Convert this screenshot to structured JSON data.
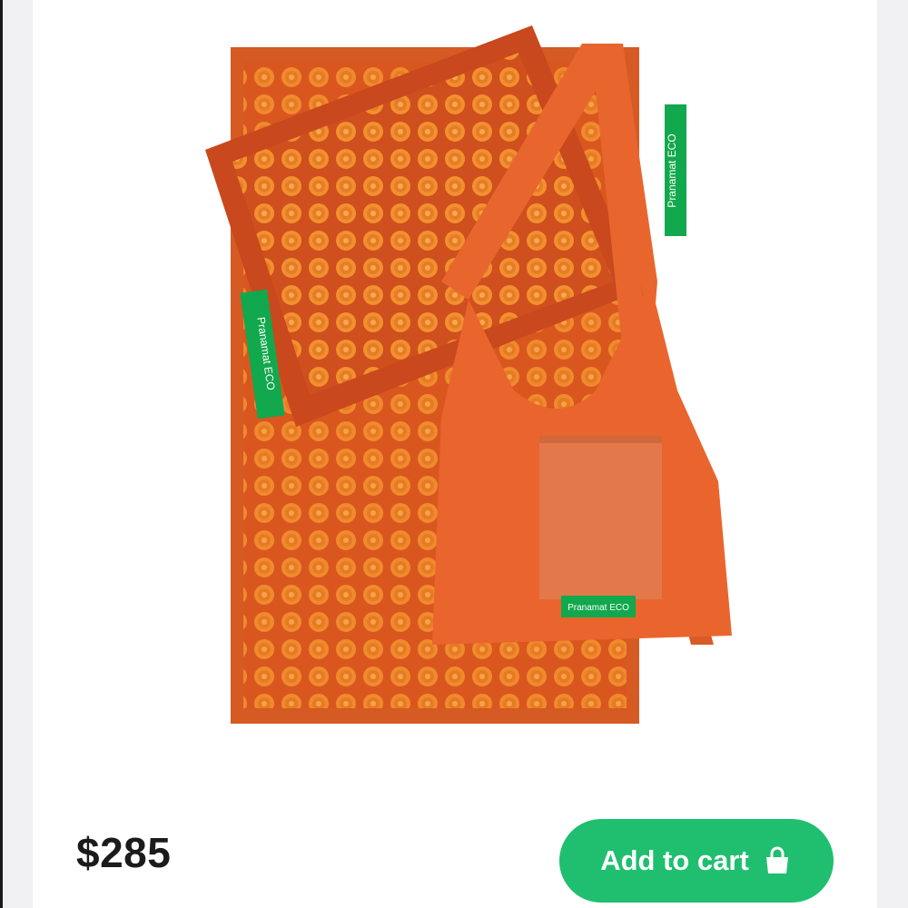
{
  "product": {
    "image_alt": "Orange acupressure mat, pillow and tote bag set",
    "mat_tag_label": "Pranamat ECO",
    "pillow_tag_label": "Pranamat ECO",
    "bag_tag_label": "Pranamat ECO",
    "price": "$285"
  },
  "actions": {
    "add_to_cart_label": "Add to cart",
    "add_to_cart_icon": "shopping-bag-icon"
  },
  "colors": {
    "accent": "#1fbf6f",
    "product_orange": "#e0622a",
    "tag_green": "#11a84e"
  }
}
